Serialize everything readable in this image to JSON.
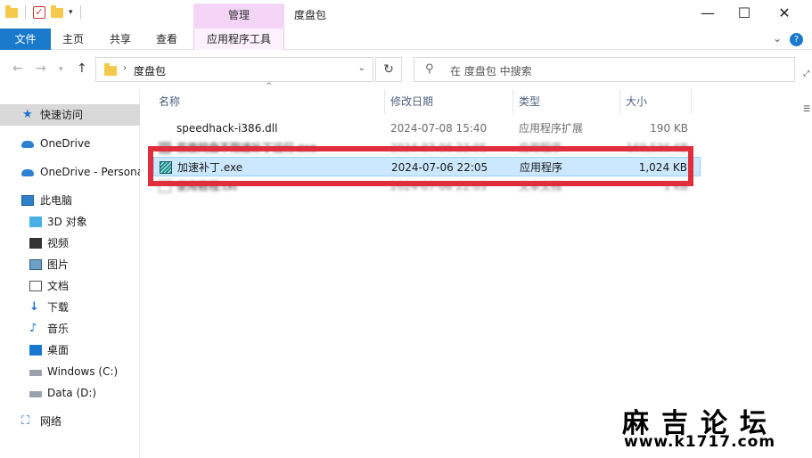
{
  "window": {
    "title": "度盘包",
    "contextual_tab": "管理",
    "controls": {
      "minimize": "—",
      "maximize": "☐",
      "close": "✕"
    }
  },
  "ribbon": {
    "tabs": [
      "文件",
      "主页",
      "共享",
      "查看",
      "应用程序工具"
    ],
    "file_tab_color": "#1979ca",
    "contextual_color": "#f4d5f7"
  },
  "address": {
    "path": "度盘包",
    "search_placeholder": "在 度盘包 中搜索"
  },
  "nav_pane": {
    "items": [
      {
        "label": "快速访问",
        "icon": "star-icon",
        "selected": true
      },
      {
        "label": "OneDrive",
        "icon": "cloud-icon"
      },
      {
        "label": "OneDrive - Persona",
        "icon": "cloud-icon"
      },
      {
        "label": "此电脑",
        "icon": "pc-icon"
      },
      {
        "label": "3D 对象",
        "icon": "cube-icon"
      },
      {
        "label": "视频",
        "icon": "video-icon"
      },
      {
        "label": "图片",
        "icon": "picture-icon"
      },
      {
        "label": "文档",
        "icon": "document-icon"
      },
      {
        "label": "下载",
        "icon": "download-icon"
      },
      {
        "label": "音乐",
        "icon": "music-icon"
      },
      {
        "label": "桌面",
        "icon": "desktop-icon"
      },
      {
        "label": "Windows (C:)",
        "icon": "drive-icon"
      },
      {
        "label": "Data (D:)",
        "icon": "drive-icon"
      },
      {
        "label": "网络",
        "icon": "network-icon"
      }
    ]
  },
  "columns": {
    "name": "名称",
    "date": "修改日期",
    "type": "类型",
    "size": "大小"
  },
  "files": [
    {
      "name": "speedhack-i386.dll",
      "date": "2024-07-08 15:40",
      "type": "应用程序扩展",
      "size": "190 KB",
      "icon": "dll-icon"
    },
    {
      "name": "百度网盘不限速补丁运行.exe",
      "date": "2024-07-06 22:05",
      "type": "应用程序",
      "size": "169,536 KB",
      "icon": "exe-icon",
      "obscured": true
    },
    {
      "name": "加速补丁.exe",
      "date": "2024-07-06 22:05",
      "type": "应用程序",
      "size": "1,024 KB",
      "icon": "patch-icon",
      "selected": true
    },
    {
      "name": "使用教程.txt",
      "date": "2024-07-06 22:05",
      "type": "文本文档",
      "size": "1 KB",
      "icon": "txt-icon",
      "obscured": true
    }
  ],
  "highlight_color": "#e02e3c",
  "watermark": {
    "title": "麻吉论坛",
    "url": "www.k1717.com"
  }
}
